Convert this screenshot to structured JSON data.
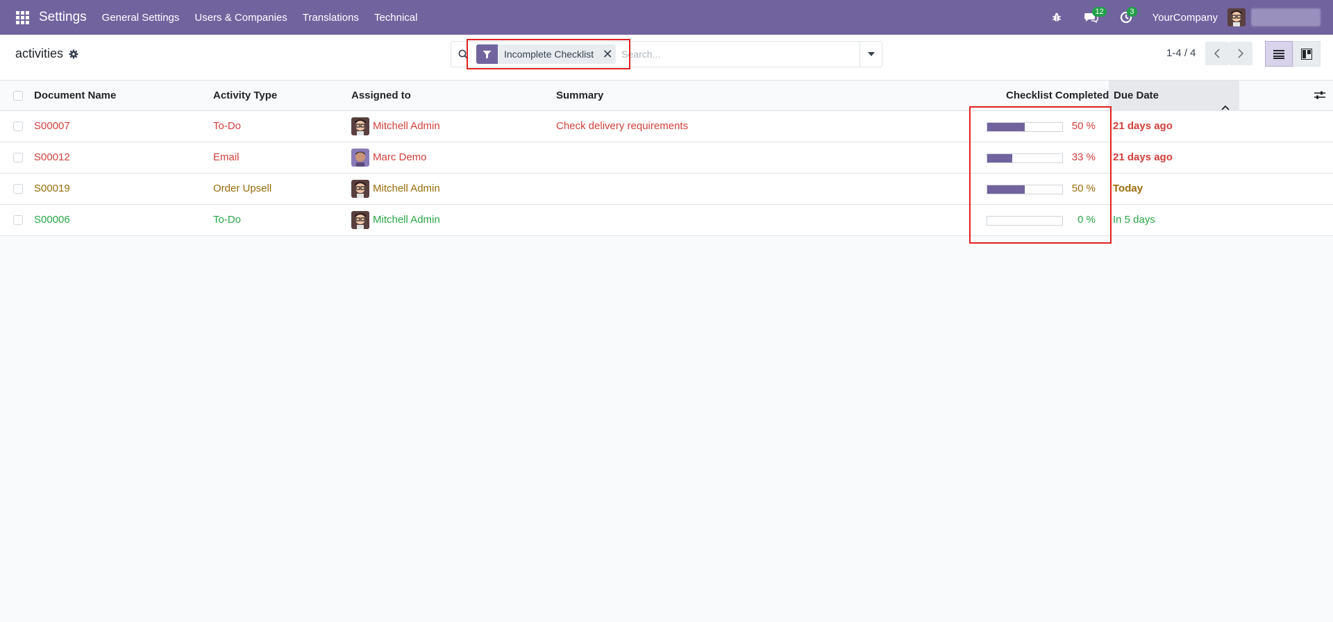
{
  "navbar": {
    "app_title": "Settings",
    "menu": [
      "General Settings",
      "Users & Companies",
      "Translations",
      "Technical"
    ],
    "messages_count": "12",
    "activities_count": "3",
    "company": "YourCompany"
  },
  "control": {
    "breadcrumb": "activities",
    "facet_label": "Incomplete Checklist",
    "facet_close": "✕",
    "search_placeholder": "Search...",
    "pager": "1-4 / 4"
  },
  "table": {
    "columns": {
      "document_name": "Document Name",
      "activity_type": "Activity Type",
      "assigned_to": "Assigned to",
      "summary": "Summary",
      "checklist_completed": "Checklist Completed",
      "due_date": "Due Date"
    },
    "rows": [
      {
        "document": "S00007",
        "activity_type": "To-Do",
        "assigned": "Mitchell Admin",
        "summary": "Check delivery requirements",
        "progress": 50,
        "progress_label": "50 %",
        "due": "21 days ago",
        "status": "overdue"
      },
      {
        "document": "S00012",
        "activity_type": "Email",
        "assigned": "Marc Demo",
        "summary": "",
        "progress": 33,
        "progress_label": "33 %",
        "due": "21 days ago",
        "status": "overdue"
      },
      {
        "document": "S00019",
        "activity_type": "Order Upsell",
        "assigned": "Mitchell Admin",
        "summary": "",
        "progress": 50,
        "progress_label": "50 %",
        "due": "Today",
        "status": "today"
      },
      {
        "document": "S00006",
        "activity_type": "To-Do",
        "assigned": "Mitchell Admin",
        "summary": "",
        "progress": 0,
        "progress_label": "0 %",
        "due": "In 5 days",
        "status": "planned"
      }
    ]
  },
  "colors": {
    "brand": "#71639e",
    "overdue": "#d23f3a",
    "today": "#9a6b08",
    "planned": "#28a745"
  },
  "icons": {
    "apps": "apps-grid-icon",
    "bug": "bug-icon",
    "chat": "chat-icon",
    "activity": "clock-icon",
    "gear": "gear-icon",
    "search": "search-icon",
    "filter": "filter-icon",
    "list_view": "list-view-icon",
    "kanban_view": "kanban-view-icon",
    "optional_columns": "sliders-icon"
  }
}
